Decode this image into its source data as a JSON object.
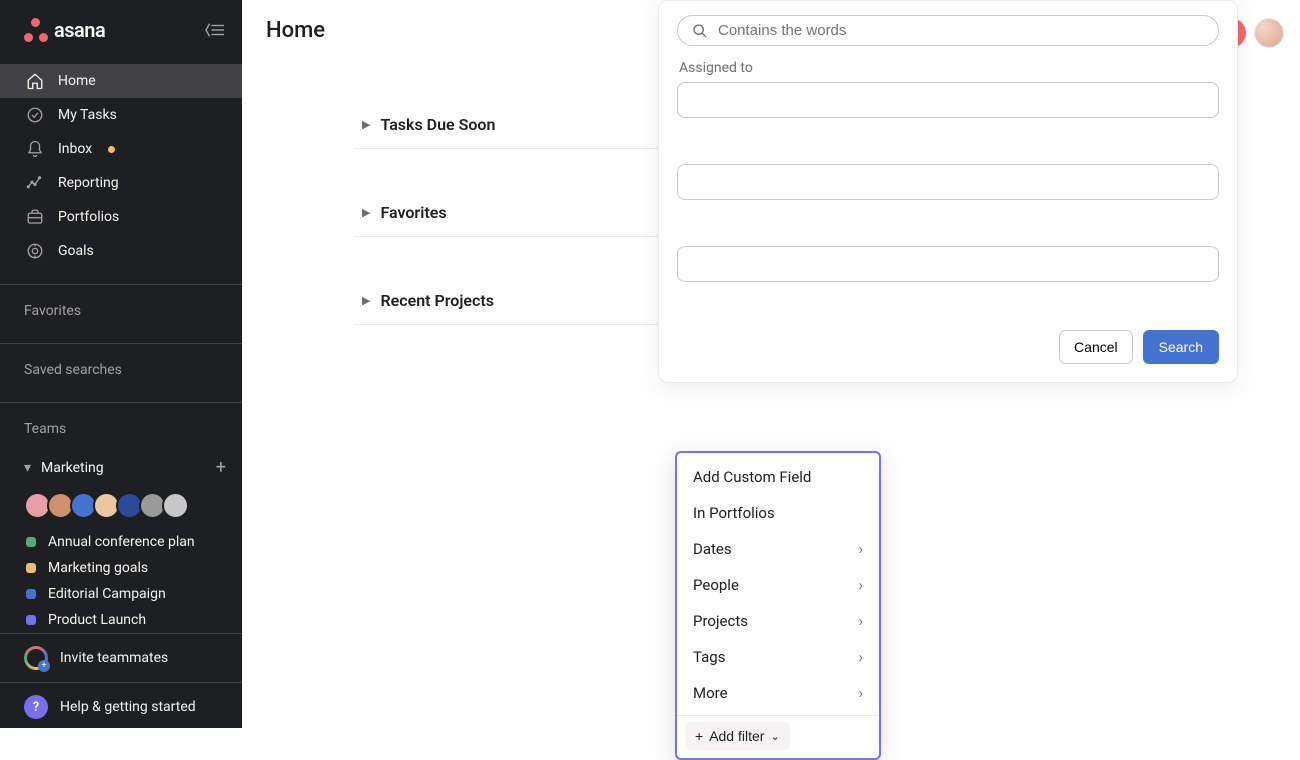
{
  "brand": {
    "name": "asana"
  },
  "sidebar": {
    "nav": [
      {
        "label": "Home",
        "icon": "home-icon",
        "active": true
      },
      {
        "label": "My Tasks",
        "icon": "check-circle-icon"
      },
      {
        "label": "Inbox",
        "icon": "bell-icon",
        "badge": true
      },
      {
        "label": "Reporting",
        "icon": "chart-line-icon"
      },
      {
        "label": "Portfolios",
        "icon": "briefcase-icon"
      },
      {
        "label": "Goals",
        "icon": "target-icon"
      }
    ],
    "favorites_label": "Favorites",
    "saved_searches_label": "Saved searches",
    "teams_label": "Teams",
    "team": {
      "name": "Marketing",
      "avatars": [
        "#e8a0a8",
        "#d09070",
        "#4573d2",
        "#e8c8a0",
        "#2a4a9a",
        "#9a9a9a",
        "#c8c8c8"
      ],
      "projects": [
        {
          "label": "Annual conference plan",
          "color": "#5da283"
        },
        {
          "label": "Marketing goals",
          "color": "#f1bd6c"
        },
        {
          "label": "Editorial Campaign",
          "color": "#4573d2"
        },
        {
          "label": "Product Launch",
          "color": "#7a6ff0"
        }
      ]
    },
    "invite_label": "Invite teammates",
    "help_label": "Help & getting started"
  },
  "main": {
    "title": "Home",
    "sections": [
      {
        "label": "Tasks Due Soon"
      },
      {
        "label": "Favorites"
      },
      {
        "label": "Recent Projects"
      }
    ]
  },
  "search_panel": {
    "placeholder": "Contains the words",
    "assigned_to_label": "Assigned to",
    "add_filter_label": "Add filter",
    "cancel_label": "Cancel",
    "search_label": "Search",
    "filter_menu": [
      {
        "label": "Add Custom Field",
        "submenu": false
      },
      {
        "label": "In Portfolios",
        "submenu": false
      },
      {
        "label": "Dates",
        "submenu": true
      },
      {
        "label": "People",
        "submenu": true
      },
      {
        "label": "Projects",
        "submenu": true
      },
      {
        "label": "Tags",
        "submenu": true
      },
      {
        "label": "More",
        "submenu": true
      }
    ]
  }
}
